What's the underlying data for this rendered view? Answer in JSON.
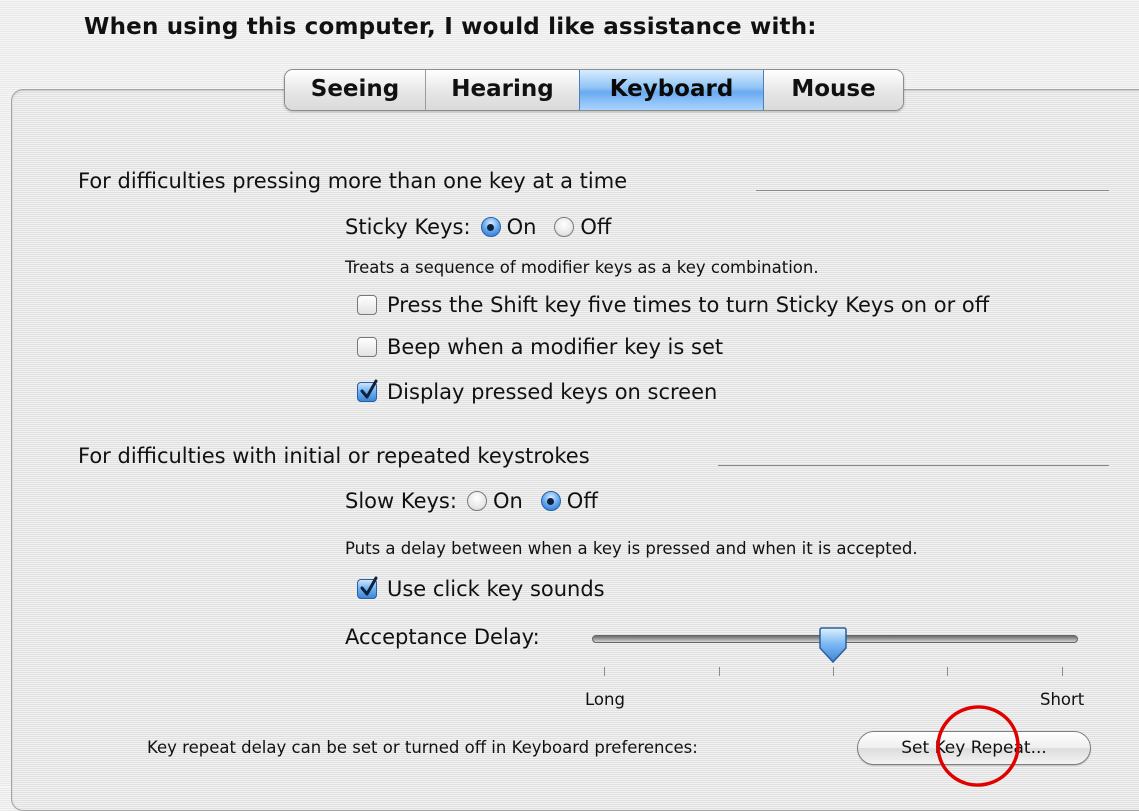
{
  "heading": "When using this computer, I would like assistance with:",
  "tabs": [
    {
      "label": "Seeing",
      "active": false
    },
    {
      "label": "Hearing",
      "active": false
    },
    {
      "label": "Keyboard",
      "active": true
    },
    {
      "label": "Mouse",
      "active": false
    }
  ],
  "sticky_section": {
    "title": "For difficulties pressing more than one key at a time",
    "sticky_keys": {
      "label": "Sticky Keys:",
      "on_label": "On",
      "off_label": "Off",
      "selected": "On"
    },
    "description": "Treats a sequence of modifier keys as a key combination.",
    "options": [
      {
        "label": "Press the Shift key five times to turn Sticky Keys on or off",
        "checked": false
      },
      {
        "label": "Beep when a modifier key is set",
        "checked": false
      },
      {
        "label": "Display pressed keys on screen",
        "checked": true
      }
    ]
  },
  "slow_section": {
    "title": "For difficulties with initial or repeated keystrokes",
    "slow_keys": {
      "label": "Slow Keys:",
      "on_label": "On",
      "off_label": "Off",
      "selected": "Off"
    },
    "description": "Puts a delay between when a key is pressed and when it is accepted.",
    "click_sounds": {
      "label": "Use click key sounds",
      "checked": true
    },
    "acceptance_delay": {
      "label": "Acceptance Delay:",
      "min_label": "Long",
      "max_label": "Short",
      "value_fraction": 0.5,
      "tick_count": 5
    }
  },
  "key_repeat": {
    "text": "Key repeat delay can be set or turned off in Keyboard preferences:",
    "button_label": "Set Key Repeat..."
  },
  "colors": {
    "selected_tab": "#6aaaf0",
    "annotation_circle": "#e00000"
  }
}
